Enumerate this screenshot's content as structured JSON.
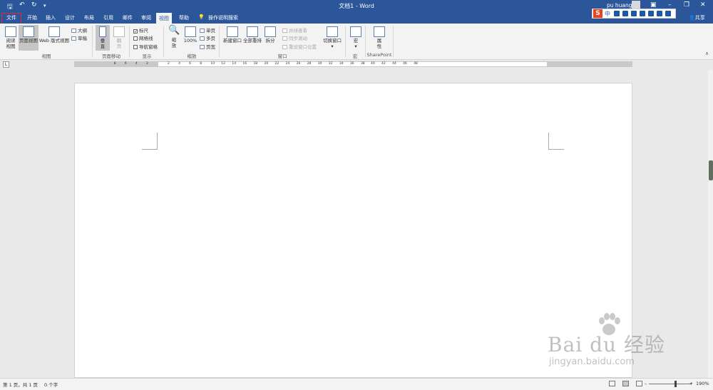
{
  "window": {
    "title": "文档1 - Word",
    "user": "pu huang",
    "share": "共享"
  },
  "tabs": [
    "文件",
    "开始",
    "插入",
    "设计",
    "布局",
    "引用",
    "邮件",
    "审阅",
    "视图",
    "帮助"
  ],
  "active_tab": "视图",
  "search": "操作说明搜索",
  "ime": {
    "char": "中"
  },
  "ribbon": {
    "read_view": "阅读\n视图",
    "page_view": "页面视图",
    "web_view": "Web 版式视图",
    "outline": "大纲",
    "draft": "草稿",
    "group_views": "视图",
    "vertical": "垂\n直",
    "side": "翻\n页",
    "group_page_move": "页面移动",
    "ruler": "标尺",
    "gridlines": "网格线",
    "nav_pane": "导航窗格",
    "group_show": "显示",
    "zoom": "缩\n放",
    "zoom100": "100%",
    "one_page": "单页",
    "multi_page": "多页",
    "page_width": "页宽",
    "group_zoom": "缩放",
    "new_window": "新建窗口",
    "arrange_all": "全部重排",
    "split": "拆分",
    "side_by_side": "并排查看",
    "sync_scroll": "同步滚动",
    "reset_pos": "重设窗口位置",
    "switch_window": "切换窗口",
    "group_window": "窗口",
    "macros": "宏",
    "group_macros": "宏",
    "properties": "属\n性",
    "group_sharepoint": "SharePoint"
  },
  "ruler": {
    "left_numbers": [
      "8",
      "6",
      "4",
      "2"
    ],
    "numbers": [
      "2",
      "4",
      "6",
      "8",
      "10",
      "12",
      "14",
      "16",
      "18",
      "20",
      "22",
      "24",
      "26",
      "28",
      "30",
      "32",
      "34",
      "36",
      "38"
    ],
    "right_numbers": [
      "40",
      "42",
      "44",
      "46",
      "48"
    ]
  },
  "status": {
    "page": "第 1 页，共 1 页",
    "words": "0 个字",
    "zoom": "190%"
  },
  "watermark": {
    "main": "Bai du 经验",
    "sub": "jingyan.baidu.com"
  },
  "colors": {
    "title_bar": "#2b579a",
    "file_highlight": "#e52a2a"
  }
}
